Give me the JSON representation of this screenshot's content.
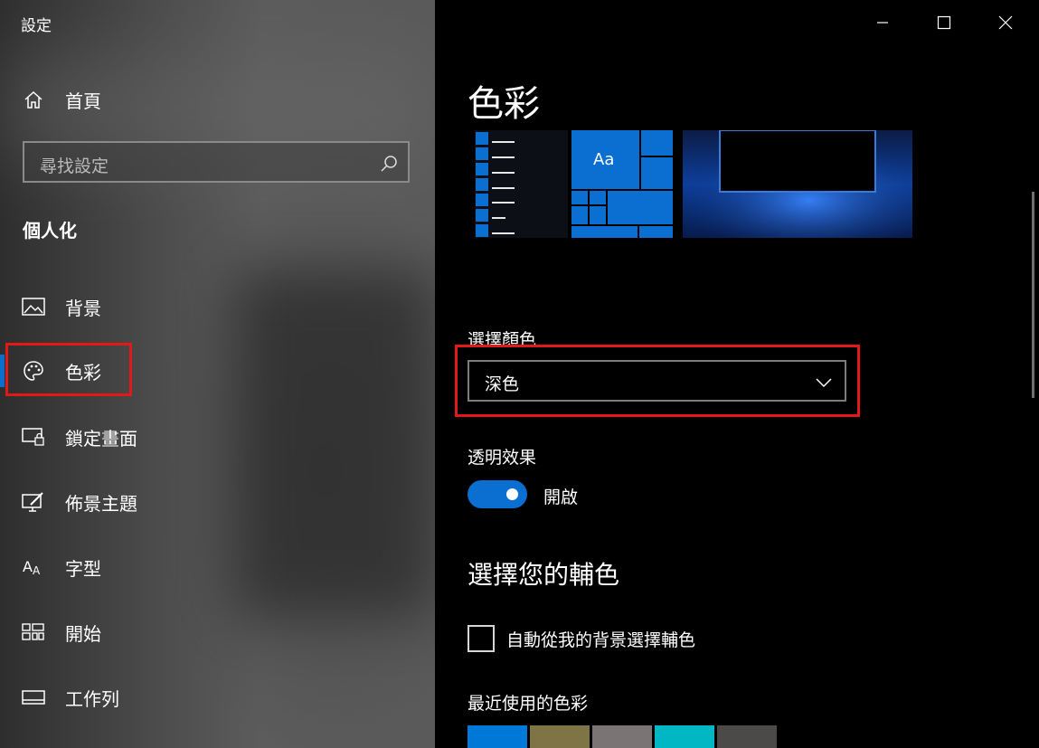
{
  "window": {
    "title": "設定"
  },
  "sidebar": {
    "home_label": "首頁",
    "search_placeholder": "尋找設定",
    "section_title": "個人化",
    "items": [
      {
        "label": "背景",
        "icon": "picture-icon"
      },
      {
        "label": "色彩",
        "icon": "palette-icon",
        "selected": true
      },
      {
        "label": "鎖定畫面",
        "icon": "lock-screen-icon"
      },
      {
        "label": "佈景主題",
        "icon": "themes-icon"
      },
      {
        "label": "字型",
        "icon": "fonts-icon"
      },
      {
        "label": "開始",
        "icon": "start-icon"
      },
      {
        "label": "工作列",
        "icon": "taskbar-icon"
      }
    ]
  },
  "main": {
    "title": "色彩",
    "preview_tile_text": "Aa",
    "choose_color_label": "選擇顏色",
    "choose_color_value": "深色",
    "transparency_label": "透明效果",
    "transparency_state": "開啟",
    "accent_heading": "選擇您的輔色",
    "auto_accent_label": "自動從我的背景選擇輔色",
    "recent_colors_label": "最近使用的色彩",
    "recent_colors": [
      "#0078d7",
      "#7e7445",
      "#7a7574",
      "#00b7c3",
      "#4c4a48"
    ]
  },
  "colors": {
    "accent": "#0a6fd0",
    "highlight": "#e11919"
  }
}
